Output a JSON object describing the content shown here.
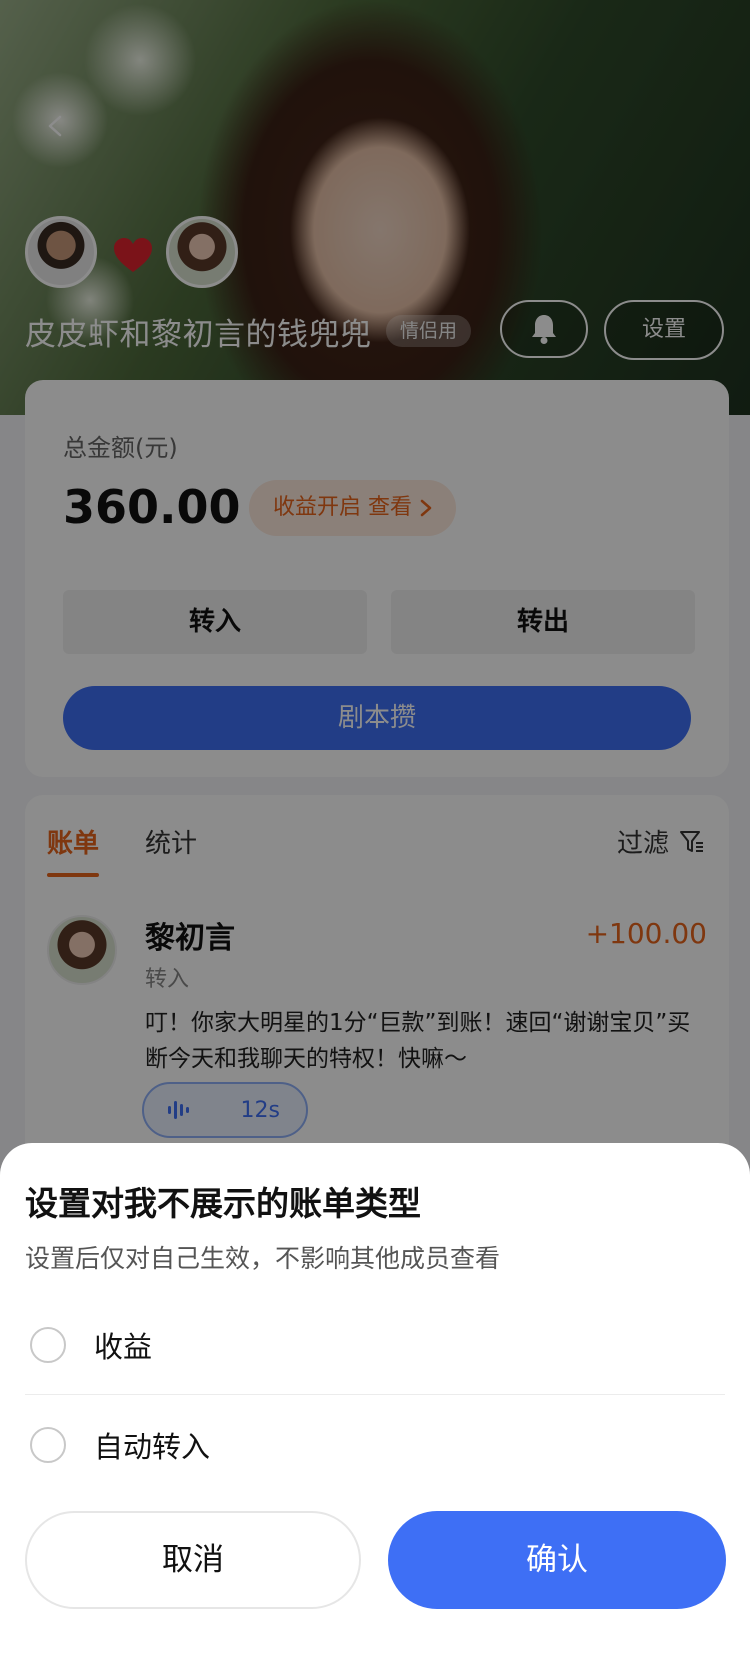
{
  "header": {
    "wallet_title": "皮皮虾和黎初言的钱兜兜",
    "couple_badge": "情侣用",
    "settings_label": "设置"
  },
  "balance": {
    "total_label": "总金额(元)",
    "total_amount": "360.00",
    "earnings_pill": "收益开启  查看",
    "transfer_in_label": "转入",
    "transfer_out_label": "转出",
    "script_label": "剧本攒"
  },
  "bills": {
    "tabs": [
      {
        "label": "账单",
        "active": true
      },
      {
        "label": "统计",
        "active": false
      }
    ],
    "filter_label": "过滤",
    "items": [
      {
        "name": "黎初言",
        "type": "转入",
        "amount": "+100.00",
        "message": "叮！你家大明星的1分“巨款”到账！速回“谢谢宝贝”买断今天和我聊天的特权！快嘛～",
        "voice_duration": "12s"
      }
    ]
  },
  "sheet": {
    "title": "设置对我不展示的账单类型",
    "subtitle": "设置后仅对自己生效，不影响其他成员查看",
    "options": [
      {
        "label": "收益",
        "checked": false
      },
      {
        "label": "自动转入",
        "checked": false
      }
    ],
    "cancel_label": "取消",
    "confirm_label": "确认"
  },
  "colors": {
    "accent_blue": "#3e6ff5",
    "accent_orange": "#e8641c",
    "heart_red": "#e0242f"
  },
  "icons": [
    "chevron-left-icon",
    "heart-icon",
    "bell-icon",
    "chevron-right-icon",
    "filter-icon",
    "voice-wave-icon"
  ]
}
